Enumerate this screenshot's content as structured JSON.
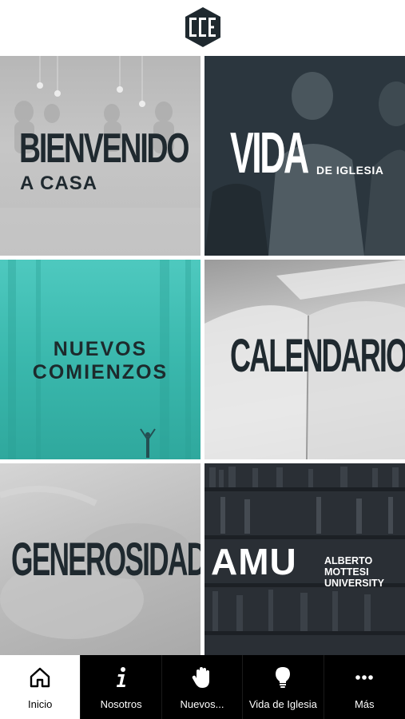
{
  "header": {
    "logo_text": "CCE"
  },
  "tiles": {
    "bienvenido": {
      "title": "BIENVENIDO",
      "subtitle": "A CASA"
    },
    "vida": {
      "title": "VIDA",
      "subtitle": "DE IGLESIA"
    },
    "nuevos": {
      "line1": "NUEVOS",
      "line2": "COMIENZOS"
    },
    "calendario": {
      "title": "CALENDARIO"
    },
    "generosidad": {
      "title": "GENEROSIDAD"
    },
    "amu": {
      "title": "AMU",
      "line1": "ALBERTO",
      "line2": "MOTTESI",
      "line3": "UNIVERSITY"
    }
  },
  "tabbar": {
    "active_index": 0,
    "items": [
      {
        "label": "Inicio",
        "icon": "home-icon"
      },
      {
        "label": "Nosotros",
        "icon": "info-icon"
      },
      {
        "label": "Nuevos...",
        "icon": "hand-icon"
      },
      {
        "label": "Vida de Iglesia",
        "icon": "lightbulb-icon"
      },
      {
        "label": "Más",
        "icon": "more-icon"
      }
    ]
  },
  "colors": {
    "tabbar_bg": "#000000",
    "tab_active_bg": "#ffffff",
    "teal_tile": "#3ab8ad",
    "dark_text": "#1f292f"
  }
}
